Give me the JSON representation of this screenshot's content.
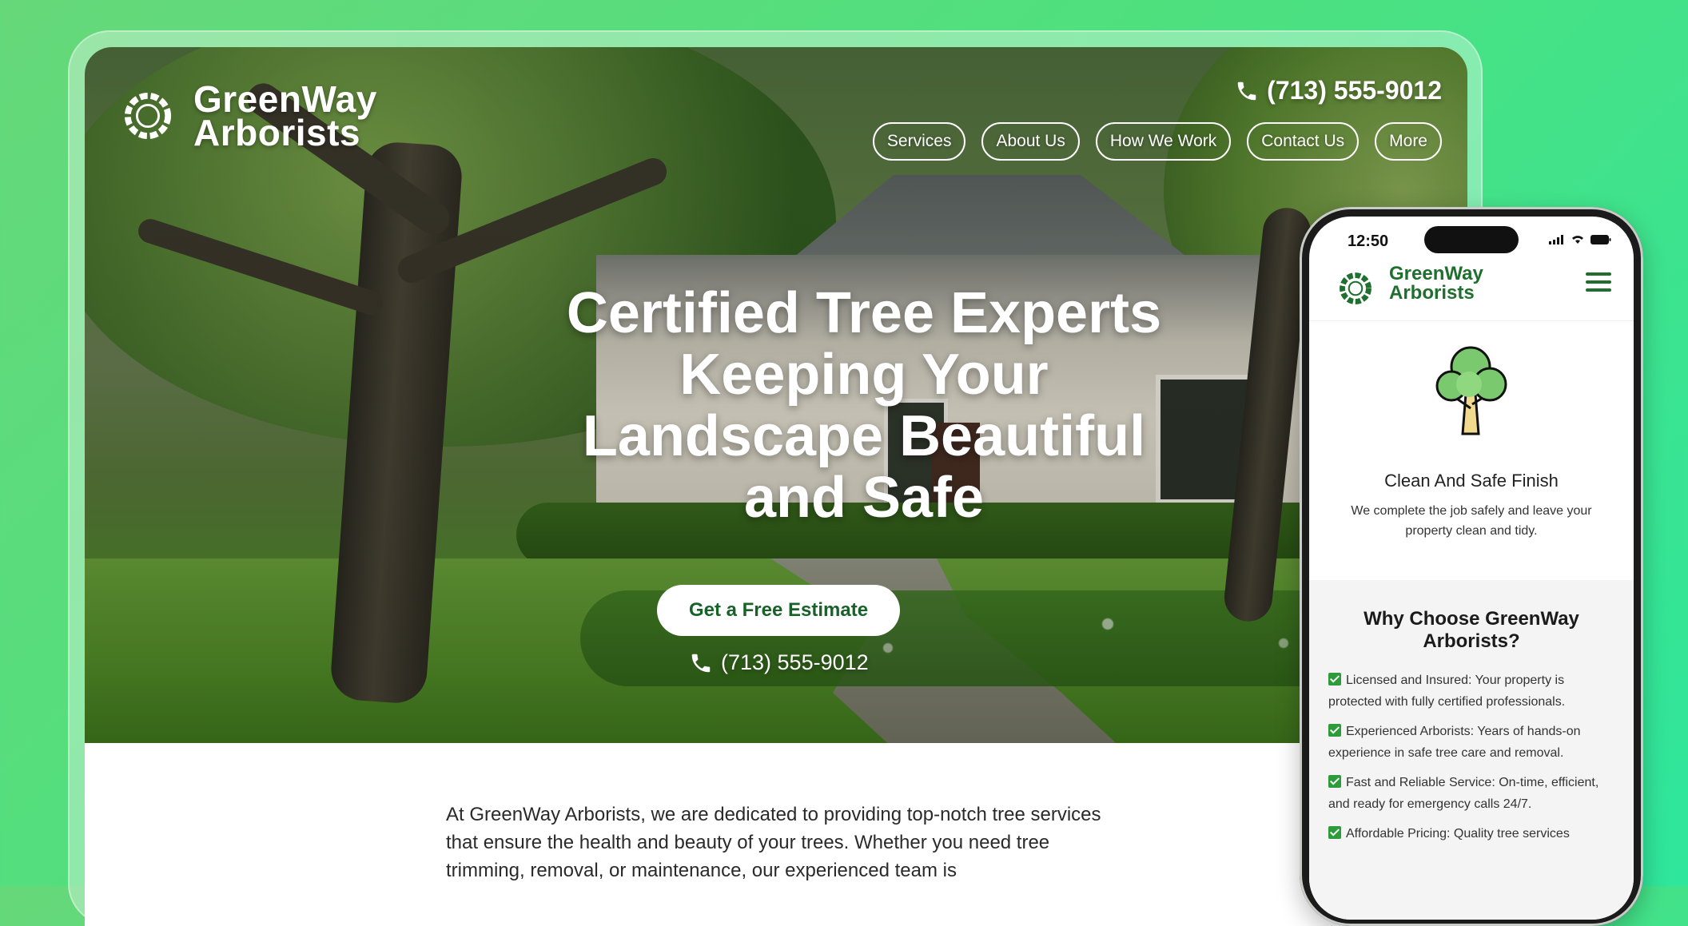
{
  "brand": {
    "name_line1": "GreenWay",
    "name_line2": "Arborists"
  },
  "header": {
    "phone": "(713) 555-9012"
  },
  "nav": {
    "items": [
      {
        "label": "Services"
      },
      {
        "label": "About Us"
      },
      {
        "label": "How We Work"
      },
      {
        "label": "Contact Us"
      },
      {
        "label": "More"
      }
    ]
  },
  "hero": {
    "title_lines": [
      "Certified Tree Experts",
      "Keeping Your",
      "Landscape Beautiful",
      "and Safe"
    ],
    "cta_label": "Get a Free Estimate",
    "phone": "(713) 555-9012"
  },
  "intro": {
    "text": "At GreenWay Arborists, we are dedicated to providing top-notch tree services that ensure the health and beauty of your trees. Whether you need tree trimming, removal, or maintenance, our experienced team is"
  },
  "mobile": {
    "status": {
      "time": "12:50"
    },
    "brand": {
      "name_line1": "GreenWay",
      "name_line2": "Arborists"
    },
    "card": {
      "title": "Clean And Safe Finish",
      "text": "We complete the job safely and leave your property clean and tidy."
    },
    "why": {
      "title": "Why Choose GreenWay Arborists?",
      "items": [
        "Licensed and Insured: Your property is protected with fully certified professionals.",
        "Experienced Arborists: Years of hands-on experience in safe tree care and removal.",
        "Fast and Reliable Service: On-time, efficient, and ready for emergency calls 24/7.",
        "Affordable Pricing: Quality tree services"
      ]
    }
  },
  "colors": {
    "brand_green": "#1f6f2e",
    "check_green": "#2e9b3a",
    "background": "#4fe07e"
  }
}
